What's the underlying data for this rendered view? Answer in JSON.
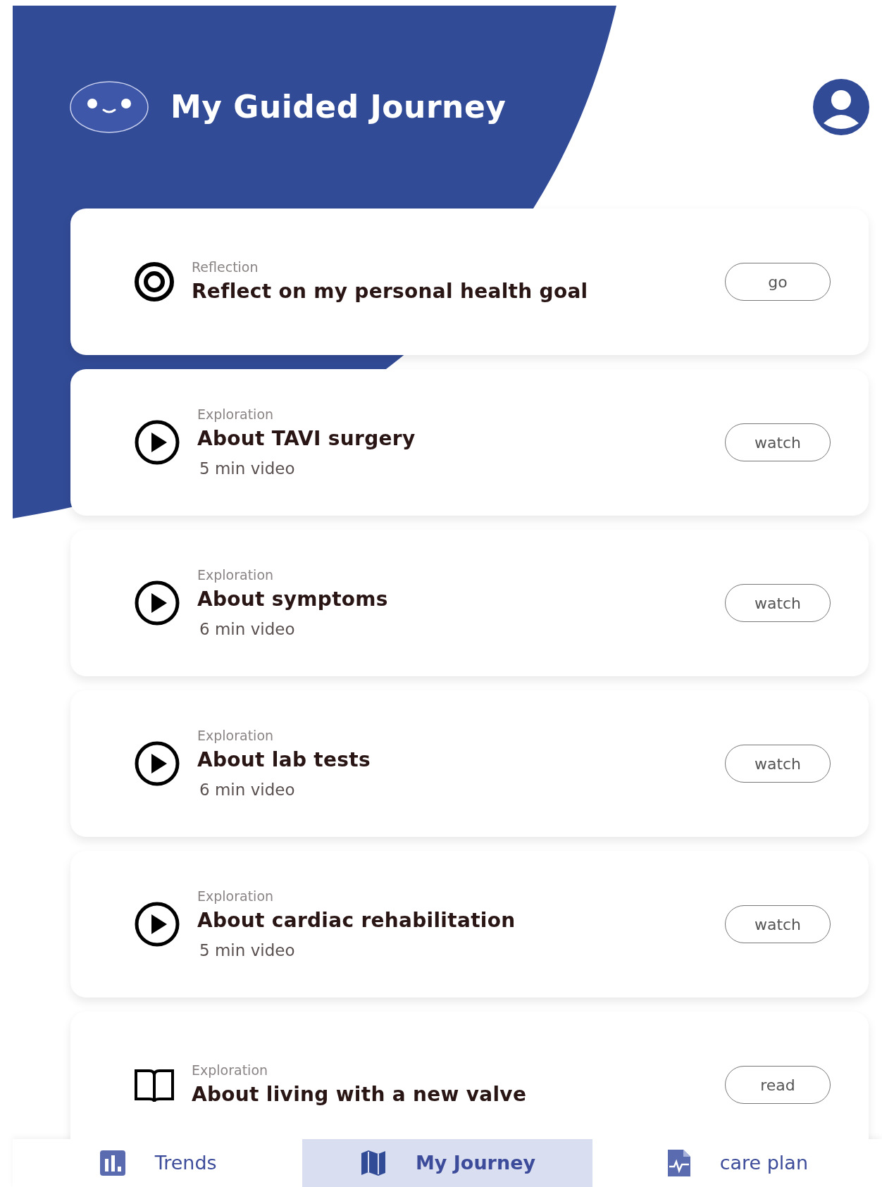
{
  "header": {
    "title": "My Guided Journey"
  },
  "cards": [
    {
      "kind": "target",
      "category": "Reflection",
      "title": "Reflect on my personal health goal",
      "action": "go"
    },
    {
      "kind": "play",
      "category": "Exploration",
      "title": "About TAVI surgery",
      "subtitle": "5 min video",
      "action": "watch"
    },
    {
      "kind": "play",
      "category": "Exploration",
      "title": "About symptoms",
      "subtitle": "6 min video",
      "action": "watch"
    },
    {
      "kind": "play",
      "category": "Exploration",
      "title": "About lab tests",
      "subtitle": "6 min video",
      "action": "watch"
    },
    {
      "kind": "play",
      "category": "Exploration",
      "title": "About cardiac rehabilitation",
      "subtitle": "5 min video",
      "action": "watch"
    },
    {
      "kind": "book",
      "category": "Exploration",
      "title": "About living with a new valve",
      "action": "read"
    }
  ],
  "nav": [
    {
      "kind": "chart",
      "label": "Trends",
      "selected": false
    },
    {
      "kind": "map",
      "label": "My Journey",
      "selected": true
    },
    {
      "kind": "file",
      "label": "care plan",
      "selected": false
    }
  ]
}
